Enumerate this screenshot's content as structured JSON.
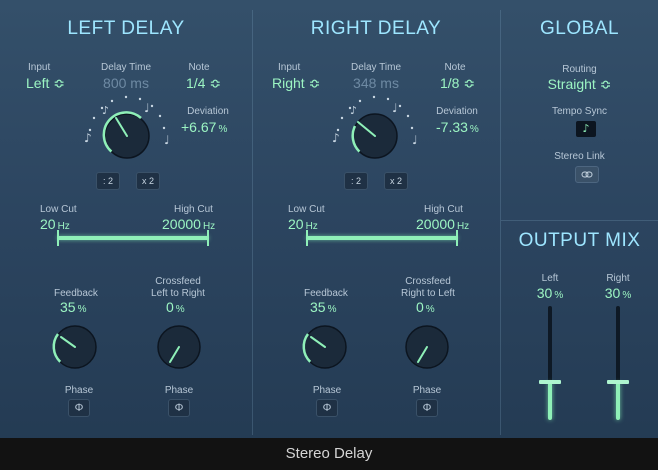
{
  "app": {
    "title": "Stereo Delay"
  },
  "left": {
    "title": "LEFT DELAY",
    "input_label": "Input",
    "input_value": "Left ≎",
    "delay_time_label": "Delay Time",
    "delay_time_value": "800 ms",
    "note_label": "Note",
    "note_value": "1/4 ≎",
    "deviation_label": "Deviation",
    "deviation_value": "+6.67",
    "deviation_unit": "%",
    "half_label": ": 2",
    "double_label": "x 2",
    "low_cut_label": "Low Cut",
    "low_cut_value": "20",
    "low_cut_unit": "Hz",
    "high_cut_label": "High Cut",
    "high_cut_value": "20000",
    "high_cut_unit": "Hz",
    "feedback_label": "Feedback",
    "feedback_value": "35",
    "feedback_unit": "%",
    "crossfeed_label_1": "Crossfeed",
    "crossfeed_label_2": "Left to Right",
    "crossfeed_value": "0",
    "crossfeed_unit": "%",
    "phase_label_1": "Phase",
    "phase_label_2": "Phase",
    "phase_symbol": "Φ"
  },
  "right": {
    "title": "RIGHT DELAY",
    "input_label": "Input",
    "input_value": "Right ≎",
    "delay_time_label": "Delay Time",
    "delay_time_value": "348 ms",
    "note_label": "Note",
    "note_value": "1/8 ≎",
    "deviation_label": "Deviation",
    "deviation_value": "-7.33",
    "deviation_unit": "%",
    "half_label": ": 2",
    "double_label": "x 2",
    "low_cut_label": "Low Cut",
    "low_cut_value": "20",
    "low_cut_unit": "Hz",
    "high_cut_label": "High Cut",
    "high_cut_value": "20000",
    "high_cut_unit": "Hz",
    "feedback_label": "Feedback",
    "feedback_value": "35",
    "feedback_unit": "%",
    "crossfeed_label_1": "Crossfeed",
    "crossfeed_label_2": "Right to Left",
    "crossfeed_value": "0",
    "crossfeed_unit": "%",
    "phase_label_1": "Phase",
    "phase_label_2": "Phase",
    "phase_symbol": "Φ"
  },
  "global": {
    "title": "GLOBAL",
    "routing_label": "Routing",
    "routing_value": "Straight ≎",
    "tempo_sync_label": "Tempo Sync",
    "tempo_sync_symbol": "♪",
    "stereo_link_label": "Stereo Link",
    "stereo_link_icon": "link-icon"
  },
  "output_mix": {
    "title": "OUTPUT MIX",
    "left_label": "Left",
    "left_value": "30",
    "left_unit": "%",
    "right_label": "Right",
    "right_value": "30",
    "right_unit": "%"
  },
  "colors": {
    "accent": "#8ff0b8",
    "heading": "#9ee6ff",
    "panel": "#2c4560"
  }
}
